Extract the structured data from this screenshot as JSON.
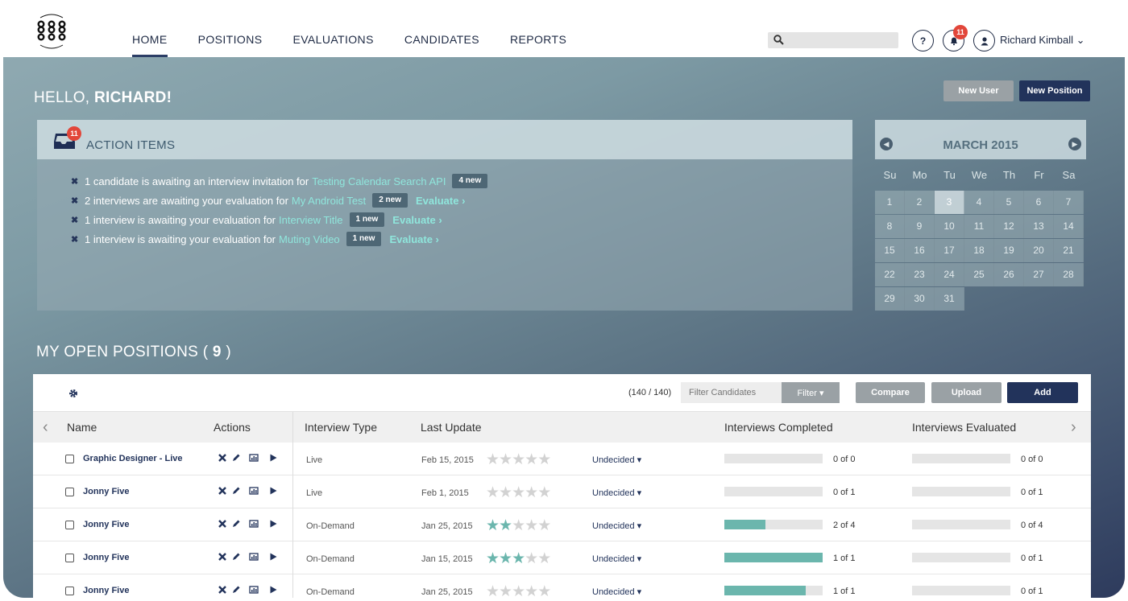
{
  "nav": {
    "items": [
      {
        "label": "HOME",
        "active": true
      },
      {
        "label": "POSITIONS",
        "active": false
      },
      {
        "label": "EVALUATIONS",
        "active": false
      },
      {
        "label": "CANDIDATES",
        "active": false
      },
      {
        "label": "REPORTS",
        "active": false
      }
    ],
    "search_placeholder": "",
    "help_label": "?",
    "notification_count": "11",
    "user_name": "Richard Kimball ⌄"
  },
  "greeting": {
    "prefix": "HELLO, ",
    "name": "RICHARD!"
  },
  "header_buttons": {
    "new_user": "New User",
    "new_position": "New Position"
  },
  "action_items": {
    "title": "ACTION ITEMS",
    "count": "11",
    "items": [
      {
        "text": "1 candidate is awaiting an interview invitation for",
        "link": "Testing Calendar Search API",
        "badge": "4 new",
        "evaluate": ""
      },
      {
        "text": "2 interviews are awaiting your evaluation for",
        "link": "My Android Test",
        "badge": "2 new",
        "evaluate": "Evaluate ›"
      },
      {
        "text": "1 interview is awaiting your evaluation for",
        "link": "Interview Title",
        "badge": "1 new",
        "evaluate": "Evaluate ›"
      },
      {
        "text": "1 interview is awaiting your evaluation for",
        "link": "Muting Video",
        "badge": "1 new",
        "evaluate": "Evaluate ›"
      }
    ]
  },
  "calendar": {
    "title": "MARCH 2015",
    "prev": "◀",
    "next": "▶",
    "days_of_week": [
      "Su",
      "Mo",
      "Tu",
      "We",
      "Th",
      "Fr",
      "Sa"
    ],
    "weeks": [
      [
        "1",
        "2",
        "3",
        "4",
        "5",
        "6",
        "7"
      ],
      [
        "8",
        "9",
        "10",
        "11",
        "12",
        "13",
        "14"
      ],
      [
        "15",
        "16",
        "17",
        "18",
        "19",
        "20",
        "21"
      ],
      [
        "22",
        "23",
        "24",
        "25",
        "26",
        "27",
        "28"
      ],
      [
        "29",
        "30",
        "31"
      ]
    ],
    "today": "3"
  },
  "open_positions": {
    "title_prefix": "MY OPEN POSITIONS",
    "count": "9",
    "toolbar": {
      "range": "(140 / 140)",
      "filter_placeholder": "Filter Candidates",
      "filter_label": "Filter ▾",
      "compare_label": "Compare",
      "upload_label": "Upload",
      "add_label": "Add"
    },
    "columns": {
      "name": "Name",
      "actions": "Actions",
      "interview_type": "Interview Type",
      "last_update": "Last Update",
      "interviews_completed": "Interviews Completed",
      "interviews_evaluated": "Interviews Evaluated"
    },
    "rows": [
      {
        "name": "Graphic Designer - Live",
        "type": "Live",
        "date": "Feb 15, 2015",
        "rating": 0,
        "status": "Undecided ▾",
        "completed": "0 of 0",
        "completed_frac": 0,
        "evaluated": "0 of 0",
        "evaluated_frac": 0
      },
      {
        "name": "Jonny Five",
        "type": "Live",
        "date": "Feb 1, 2015",
        "rating": 0,
        "status": "Undecided ▾",
        "completed": "0 of 1",
        "completed_frac": 0,
        "evaluated": "0 of 1",
        "evaluated_frac": 0
      },
      {
        "name": "Jonny Five",
        "type": "On-Demand",
        "date": "Jan 25, 2015",
        "rating": 2,
        "status": "Undecided ▾",
        "completed": "2 of 4",
        "completed_frac": 0.42,
        "evaluated": "0 of 4",
        "evaluated_frac": 0
      },
      {
        "name": "Jonny Five",
        "type": "On-Demand",
        "date": "Jan 15, 2015",
        "rating": 3,
        "status": "Undecided ▾",
        "completed": "1 of 1",
        "completed_frac": 1,
        "evaluated": "0 of 1",
        "evaluated_frac": 0
      },
      {
        "name": "Jonny Five",
        "type": "On-Demand",
        "date": "Jan 25, 2015",
        "rating": 0,
        "status": "Undecided ▾",
        "completed": "1 of 1",
        "completed_frac": 0.83,
        "evaluated": "0 of 1",
        "evaluated_frac": 0
      }
    ]
  },
  "colors": {
    "navy": "#22335b",
    "teal": "#6bb6ad",
    "badge_red": "#e2463a"
  }
}
